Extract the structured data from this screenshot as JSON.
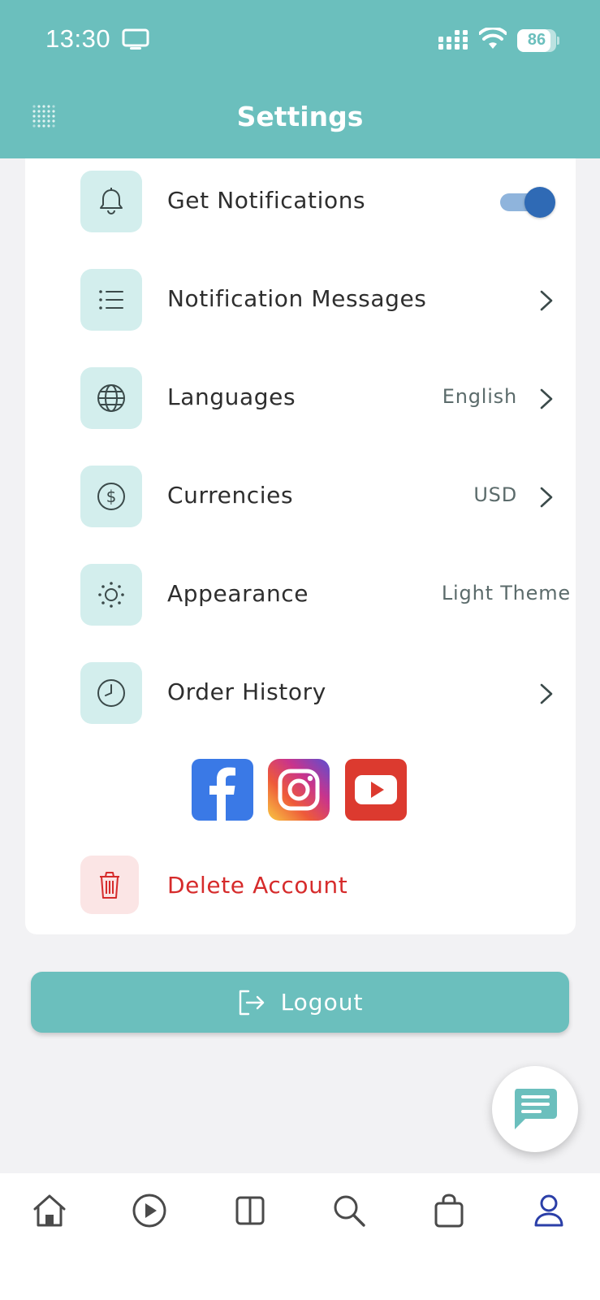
{
  "status_bar": {
    "time": "13:30",
    "battery_level": "86",
    "battery_fraction": 0.86,
    "icons": [
      "screen-icon",
      "signal-icon",
      "wifi-icon",
      "battery-icon"
    ]
  },
  "header": {
    "title": "Settings",
    "menu_icon": "grid-dots-icon",
    "background_color": "#6bbfbd"
  },
  "settings": {
    "notifications": {
      "label": "Get Notifications",
      "icon": "bell-icon",
      "enabled": true
    },
    "messages": {
      "label": "Notification Messages",
      "icon": "list-icon"
    },
    "languages": {
      "label": "Languages",
      "value": "English",
      "icon": "globe-icon"
    },
    "currencies": {
      "label": "Currencies",
      "value": "USD",
      "icon": "dollar-circle-icon"
    },
    "appearance": {
      "label": "Appearance",
      "value": "Light Theme",
      "icon": "sun-icon"
    },
    "order_history": {
      "label": "Order History",
      "icon": "clock-icon"
    }
  },
  "social": {
    "items": [
      "facebook-icon",
      "instagram-icon",
      "youtube-icon"
    ]
  },
  "delete_account": {
    "label": "Delete Account",
    "icon": "trash-icon",
    "color": "#d62b2b"
  },
  "logout": {
    "label": "Logout",
    "icon": "logout-icon"
  },
  "chat_fab": {
    "icon": "chat-icon"
  },
  "bottom_nav": {
    "items": [
      "home-icon",
      "play-icon",
      "columns-icon",
      "search-icon",
      "bag-icon",
      "profile-icon"
    ],
    "active": "profile-icon",
    "active_color": "#2b3fa8"
  }
}
